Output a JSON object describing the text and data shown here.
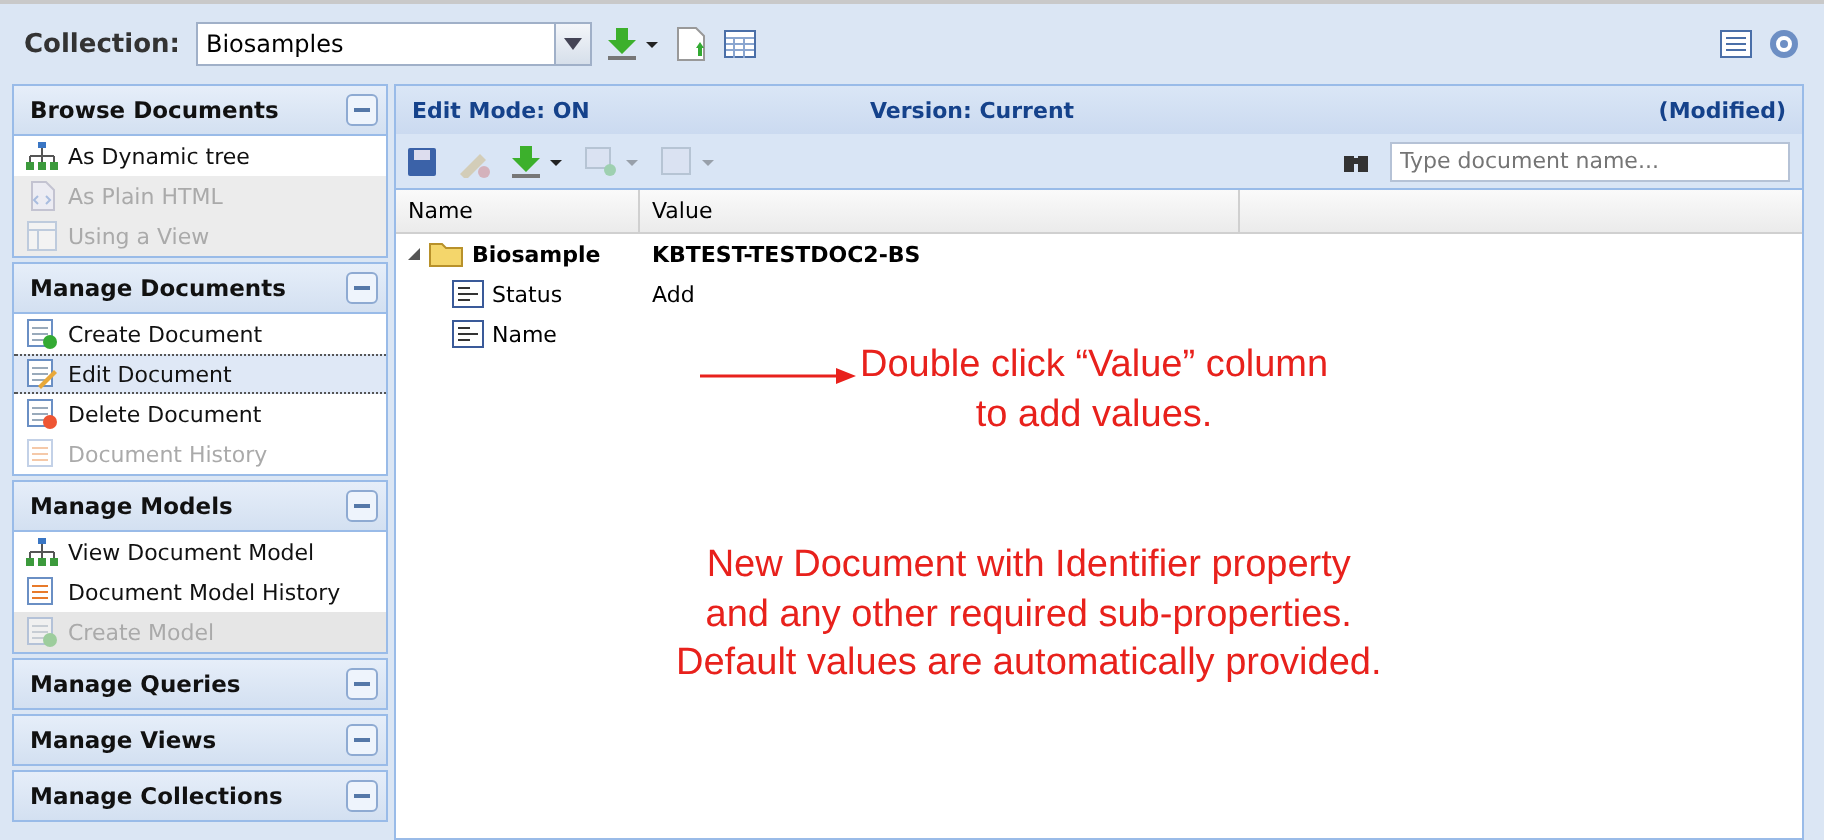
{
  "toolbar": {
    "label": "Collection:",
    "collection": "Biosamples"
  },
  "sidebar": [
    {
      "title": "Browse Documents",
      "items": [
        {
          "label": "As Dynamic tree",
          "kind": "tree",
          "selected": false,
          "disabled": false
        },
        {
          "label": "As Plain HTML",
          "kind": "html",
          "selected": false,
          "disabled": true
        },
        {
          "label": "Using a View",
          "kind": "view",
          "selected": false,
          "disabled": true
        }
      ]
    },
    {
      "title": "Manage Documents",
      "items": [
        {
          "label": "Create Document",
          "kind": "create",
          "selected": false,
          "disabled": false
        },
        {
          "label": "Edit Document",
          "kind": "edit",
          "selected": true,
          "disabled": false
        },
        {
          "label": "Delete Document",
          "kind": "delete",
          "selected": false,
          "disabled": false
        },
        {
          "label": "Document History",
          "kind": "history",
          "selected": false,
          "disabled": true
        }
      ]
    },
    {
      "title": "Manage Models",
      "items": [
        {
          "label": "View Document Model",
          "kind": "tree",
          "selected": false,
          "disabled": false
        },
        {
          "label": "Document Model History",
          "kind": "history",
          "selected": false,
          "disabled": false
        },
        {
          "label": "Create Model",
          "kind": "create",
          "selected": false,
          "disabled": true
        }
      ]
    },
    {
      "title": "Manage Queries"
    },
    {
      "title": "Manage Views"
    },
    {
      "title": "Manage Collections"
    }
  ],
  "main": {
    "edit_mode": "Edit Mode: ON",
    "version": "Version: Current",
    "modified": "(Modified)",
    "search": {
      "placeholder": "Type document name..."
    },
    "columns": [
      "Name",
      "Value"
    ],
    "tree": [
      {
        "name": "Biosample",
        "value": "KBTEST-TESTDOC2-BS",
        "kind": "folder",
        "expanded": true,
        "children": [
          {
            "name": "Status",
            "value": "Add",
            "kind": "property"
          },
          {
            "name": "Name",
            "kind": "property"
          }
        ]
      }
    ]
  },
  "annotations": [
    {
      "text": "Double click “Value” column\nto add values.",
      "kind": "arrow"
    },
    {
      "text": "New Document with Identifier property\nand any other required sub-properties.\nDefault values are automatically provided.",
      "kind": "note"
    }
  ]
}
